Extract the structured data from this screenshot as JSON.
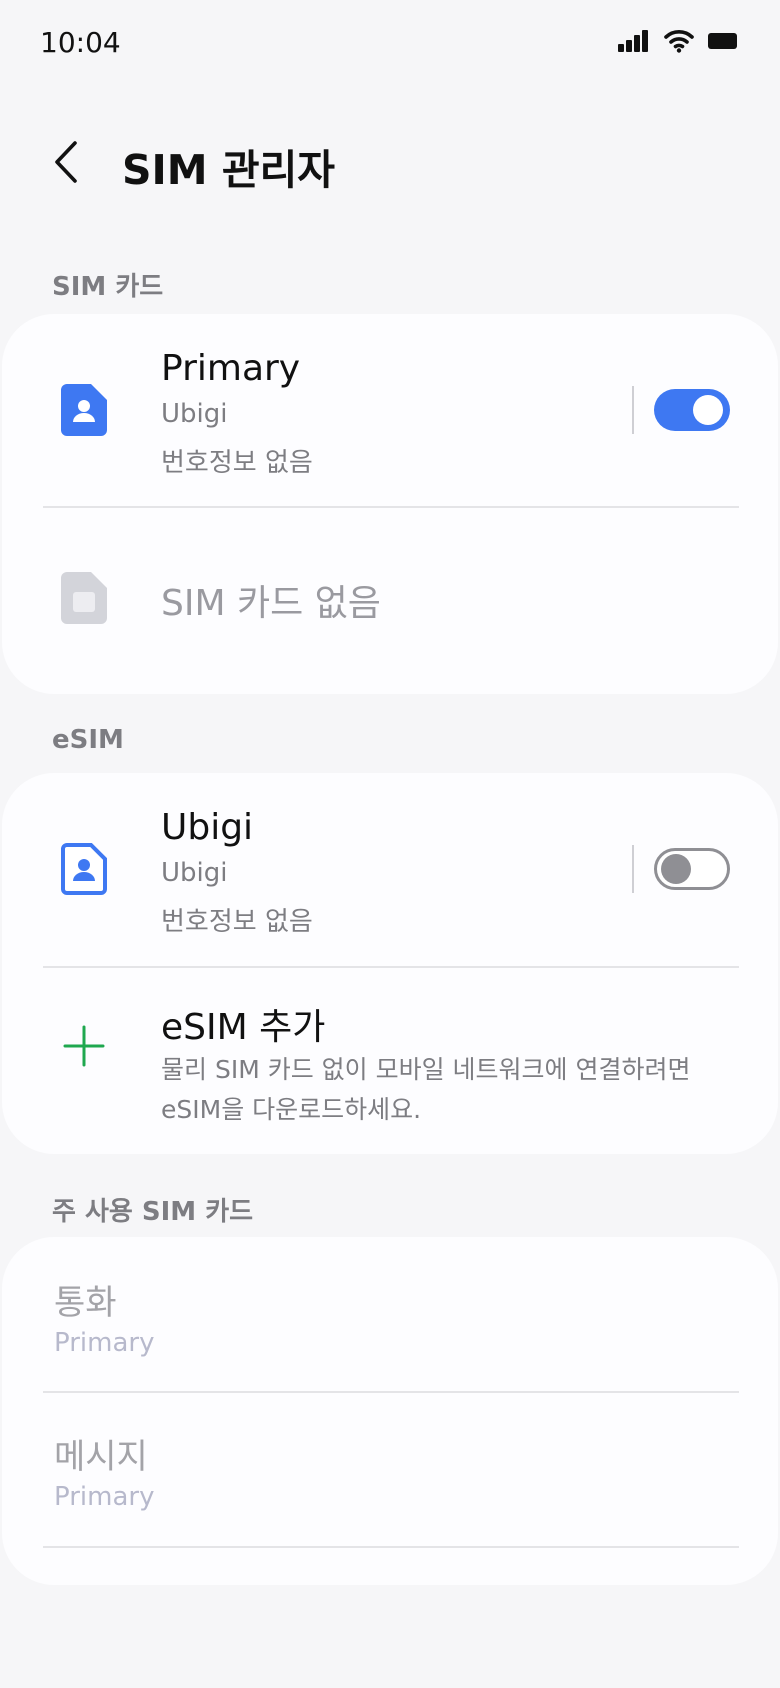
{
  "status_bar": {
    "time": "10:04",
    "icons": [
      "signal-icon",
      "wifi-icon",
      "battery-icon"
    ]
  },
  "header": {
    "title": "SIM 관리자",
    "back_icon": "chevron-left-icon"
  },
  "sections": {
    "sim_cards": {
      "label": "SIM 카드",
      "rows": [
        {
          "title": "Primary",
          "subtitle": "Ubigi",
          "detail": "번호정보 없음",
          "icon": "sim-card-icon",
          "toggle_on": true
        },
        {
          "title": "SIM 카드 없음",
          "icon": "sim-card-empty-icon"
        }
      ]
    },
    "esim": {
      "label": "eSIM",
      "rows": [
        {
          "title": "Ubigi",
          "subtitle": "Ubigi",
          "detail": "번호정보 없음",
          "icon": "esim-card-icon",
          "toggle_on": false
        },
        {
          "title": "eSIM 추가",
          "description": "물리 SIM 카드 없이 모바일 네트워크에 연결하려면 eSIM을 다운로드하세요.",
          "icon": "plus-icon"
        }
      ]
    },
    "primary_sim": {
      "label": "주 사용 SIM 카드",
      "rows": [
        {
          "title": "통화",
          "value": "Primary"
        },
        {
          "title": "메시지",
          "value": "Primary"
        }
      ]
    }
  },
  "colors": {
    "accent": "#3e78f2",
    "add_icon": "#1fa84f",
    "background": "#f6f6f8",
    "card": "#fdfdff"
  }
}
